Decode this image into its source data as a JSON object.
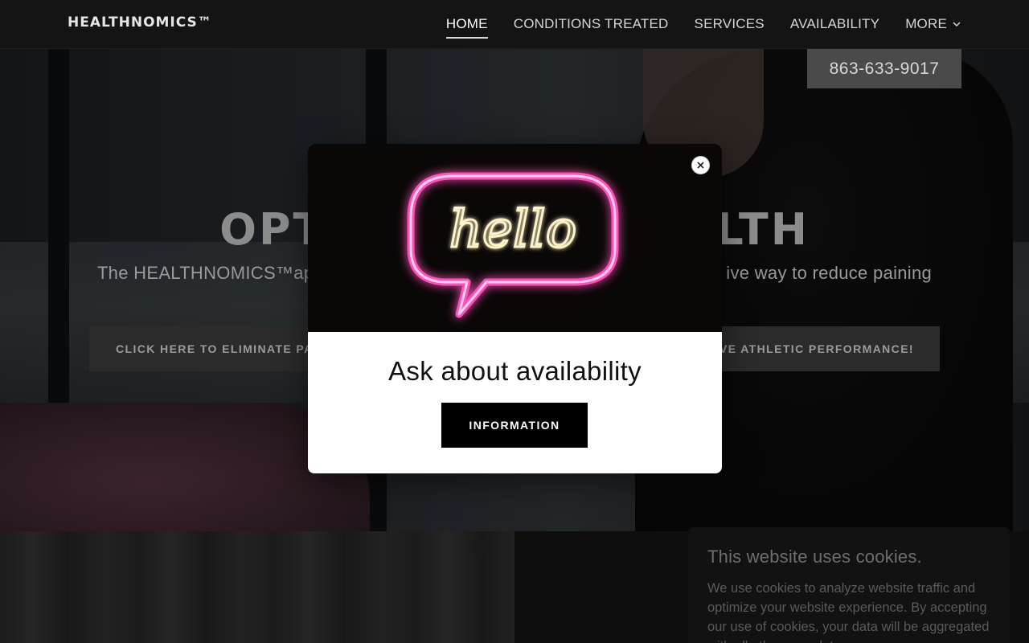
{
  "site": {
    "logo": "HEALTHNOMICS™"
  },
  "nav": {
    "items": [
      {
        "label": "HOME",
        "active": true
      },
      {
        "label": "CONDITIONS TREATED"
      },
      {
        "label": "SERVICES"
      },
      {
        "label": "AVAILABILITY"
      }
    ],
    "more_label": "MORE",
    "more_icon": "chevron-down-icon"
  },
  "hero": {
    "phone": "863-633-9017",
    "title_left": "OPT",
    "title_right": "LTH",
    "subtitle_left": "The HEALTHNOMICS™ap",
    "subtitle_right": "ive way to reduce paining",
    "cta_left": "CLICK HERE TO ELIMINATE PA",
    "cta_right": "VE ATHLETIC PERFORMANCE!"
  },
  "modal": {
    "image_text": "hello",
    "heading": "Ask about availability",
    "button_label": "INFORMATION",
    "close_icon": "close-icon",
    "neon_color": "#ff3fae"
  },
  "cookie_banner": {
    "title": "This website uses cookies.",
    "body": "We use cookies to analyze website traffic and optimize your website experience. By accepting our use of cookies, your data will be aggregated with all other user data."
  }
}
